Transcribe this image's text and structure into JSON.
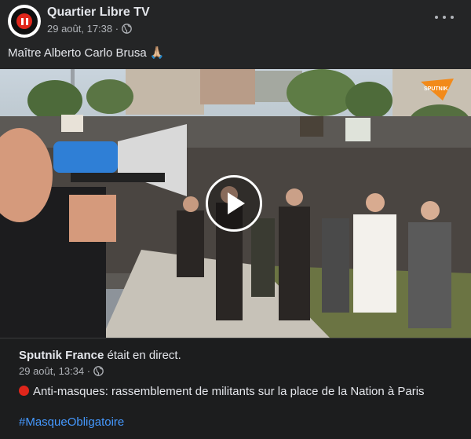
{
  "post": {
    "page_name": "Quartier Libre TV",
    "timestamp": "29 août, 17:38 ·",
    "privacy_icon": "globe-icon",
    "text": "Maître Alberto Carlo Brusa 🙏🏼",
    "more_icon": "more-options-icon"
  },
  "video": {
    "play_icon": "play-icon",
    "watermark": "SPUTNIK"
  },
  "shared": {
    "author": "Sputnik France",
    "action": " était en direct.",
    "timestamp": "29 août, 13:34 ·",
    "text": "Anti-masques: rassemblement de militants sur la place de la Nation à Paris",
    "hashtag": "#MasqueObligatoire"
  },
  "colors": {
    "background": "#242526",
    "text": "#e4e6eb",
    "secondary_text": "#b0b3b8",
    "link": "#4599ff",
    "brand_red": "#e0261b",
    "sputnik_orange": "#f28a1a"
  }
}
